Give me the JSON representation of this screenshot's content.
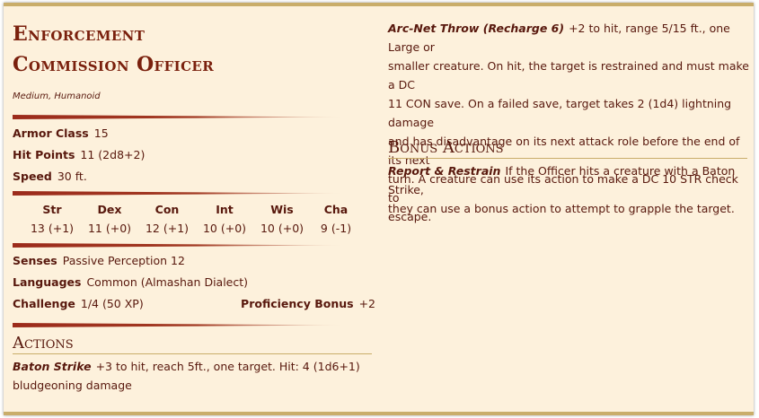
{
  "monster": {
    "name_line1": "Enforcement",
    "name_line2": "Commission Officer",
    "type": "Medium, Humanoid"
  },
  "stats": {
    "armor_class_label": "Armor Class",
    "armor_class": "15",
    "hit_points_label": "Hit Points",
    "hit_points": "11 (2d8+2)",
    "speed_label": "Speed",
    "speed": "30 ft."
  },
  "abilities": [
    {
      "name": "Str",
      "value": "13 (+1)"
    },
    {
      "name": "Dex",
      "value": "11 (+0)"
    },
    {
      "name": "Con",
      "value": "12 (+1)"
    },
    {
      "name": "Int",
      "value": "10 (+0)"
    },
    {
      "name": "Wis",
      "value": "10 (+0)"
    },
    {
      "name": "Cha",
      "value": "9 (-1)"
    }
  ],
  "details": {
    "senses_label": "Senses",
    "senses": "Passive Perception 12",
    "languages_label": "Languages",
    "languages": "Common (Almashan Dialect)",
    "challenge_label": "Challenge",
    "challenge": "1/4 (50 XP)",
    "proficiency_label": "Proficiency Bonus",
    "proficiency": "+2"
  },
  "actions": {
    "heading": "Actions",
    "baton_name": "Baton Strike",
    "baton_line1": "+3 to hit, reach 5ft., one target. Hit: 4 (1d6+1)",
    "baton_line2": "bludgeoning damage",
    "arcnet_name": "Arc-Net Throw (Recharge 6)",
    "arcnet_line1": "+2 to hit, range 5/15 ft., one Large or",
    "arcnet_line2": "smaller creature. On hit, the target is restrained and must make a DC",
    "arcnet_line3": "11 CON save. On a failed save, target takes 2 (1d4) lightning damage",
    "arcnet_line4": "and has disadvantage on its next attack role before the end of its next",
    "arcnet_line5": "turn. A creature can use its action to make a DC 10 STR check to",
    "arcnet_line6": "escape."
  },
  "bonus_actions": {
    "heading": "Bonus Actions",
    "report_name": "Report & Restrain",
    "report_line1": "If the Officer hits a creature with a Baton Strike,",
    "report_line2": "they can use a bonus action to attempt to grapple the target."
  }
}
